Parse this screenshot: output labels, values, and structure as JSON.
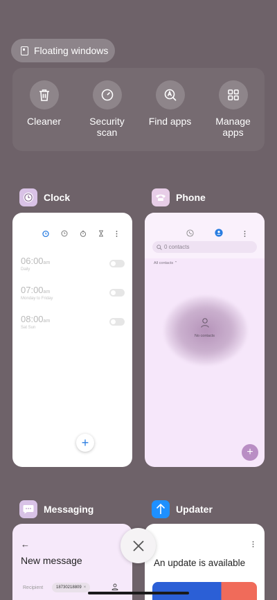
{
  "floating_windows": {
    "label": "Floating windows"
  },
  "tools": [
    {
      "label": "Cleaner",
      "icon": "trash-icon"
    },
    {
      "label": "Security\nscan",
      "icon": "speedometer-icon"
    },
    {
      "label": "Find apps",
      "icon": "find-apps-icon"
    },
    {
      "label": "Manage\napps",
      "icon": "grid-icon"
    }
  ],
  "apps": {
    "clock": {
      "name": "Clock",
      "alarms": [
        {
          "time": "06:00",
          "suffix": "am",
          "repeat": "Daily"
        },
        {
          "time": "07:00",
          "suffix": "am",
          "repeat": "Monday to Friday"
        },
        {
          "time": "08:00",
          "suffix": "am",
          "repeat": "Sat Sun"
        }
      ]
    },
    "phone": {
      "name": "Phone",
      "search_placeholder": "0 contacts",
      "filter": "All contacts",
      "empty_text": "No contacts"
    },
    "messaging": {
      "name": "Messaging",
      "title": "New message",
      "recipient_label": "Recipient",
      "recipient_chip": "18730218809"
    },
    "updater": {
      "name": "Updater",
      "title": "An update is available"
    }
  },
  "colors": {
    "background": "#6e6269",
    "clock_accent": "#2a7de1",
    "updater_accent": "#1e90ff"
  }
}
